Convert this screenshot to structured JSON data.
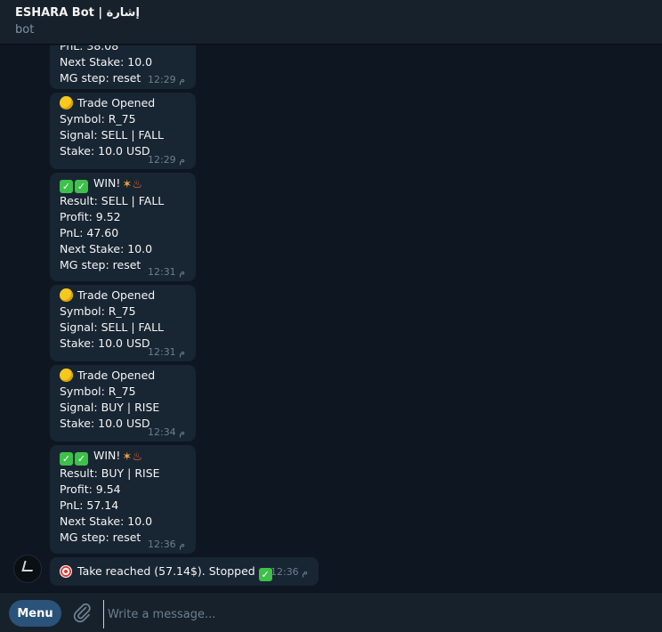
{
  "header": {
    "title": "ESHARA Bot | إشارة",
    "subtitle": "bot"
  },
  "messages": [
    {
      "lines": [
        "PnL: 38.08",
        "Next Stake: 10.0",
        "MG step: reset"
      ],
      "time": "12:29 م"
    },
    {
      "lines": [
        "Trade Opened",
        "Symbol: R_75",
        "Signal: SELL | FALL",
        "Stake: 10.0 USD"
      ],
      "time": "12:29 م"
    },
    {
      "lines": [
        "WIN!",
        "Result: SELL | FALL",
        "Profit: 9.52",
        "PnL: 47.60",
        "Next Stake: 10.0",
        "MG step: reset"
      ],
      "time": "12:31 م"
    },
    {
      "lines": [
        "Trade Opened",
        "Symbol: R_75",
        "Signal: SELL | FALL",
        "Stake: 10.0 USD"
      ],
      "time": "12:31 م"
    },
    {
      "lines": [
        "Trade Opened",
        "Symbol: R_75",
        "Signal: BUY | RISE",
        "Stake: 10.0 USD"
      ],
      "time": "12:34 م"
    },
    {
      "lines": [
        "WIN!",
        "Result: BUY | RISE",
        "Profit: 9.54",
        "PnL: 57.14",
        "Next Stake: 10.0",
        "MG step: reset"
      ],
      "time": "12:36 م"
    },
    {
      "lines": [
        "Take reached (57.14$). Stopped"
      ],
      "time": "12:36 م"
    }
  ],
  "composer": {
    "menu_label": "Menu",
    "placeholder": "Write a message..."
  },
  "icons": {
    "trade_opened": "yellow-circle-icon",
    "win": "check-mark-icon",
    "celebration": "party-popper-icon",
    "fire": "fire-icon",
    "target": "direct-hit-icon",
    "stopped": "check-mark-icon",
    "attach": "paperclip-icon"
  },
  "colors": {
    "background": "#0e1621",
    "bubble": "#182533",
    "header": "#17212b",
    "menu_button": "#2b5278"
  }
}
